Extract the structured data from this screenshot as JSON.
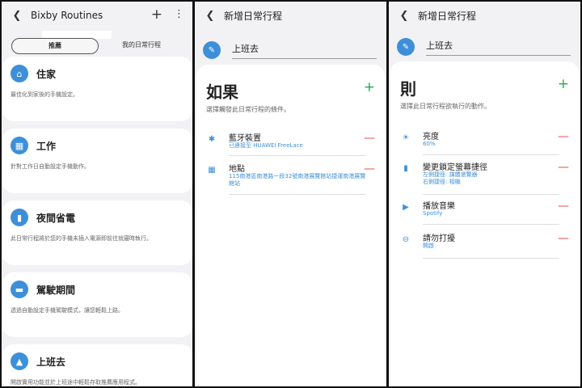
{
  "panel1": {
    "title": "Bixby Routines",
    "tabs": [
      "推薦",
      "我的日常行程"
    ],
    "cards": [
      {
        "title": "住家",
        "desc": "最佳化到家後的手機設定。",
        "icon": "home-icon",
        "glyph": "⌂"
      },
      {
        "title": "工作",
        "desc": "針對工作日自動設定手機動作。",
        "icon": "building-icon",
        "glyph": "▦"
      },
      {
        "title": "夜間省電",
        "desc": "此日常行程將於您的手機未插入電源即前往就寢時執行。",
        "icon": "battery-icon",
        "glyph": "▮"
      },
      {
        "title": "駕駛期間",
        "desc": "透過自動設定手機駕駛模式，讓您輕鬆上路。",
        "icon": "car-icon",
        "glyph": "▬"
      },
      {
        "title": "上班去",
        "desc": "開啟實用功能並於上班途中輕鬆存取推薦應用程式。",
        "icon": "commute-icon",
        "glyph": "▲"
      }
    ]
  },
  "panel2": {
    "title": "新增日常行程",
    "name": "上班去",
    "heading": "如果",
    "subtitle": "選擇觸發此日常行程的條件。",
    "items": [
      {
        "title": "藍牙裝置",
        "sub": "已連接至 HUAWEI FreeLace",
        "icon": "bluetooth-icon",
        "glyph": "✱"
      },
      {
        "title": "地點",
        "sub": "115南港區南港路一段32號南港展覽館站捷運南港展覽館站",
        "icon": "location-icon",
        "glyph": "▦"
      }
    ]
  },
  "panel3": {
    "title": "新增日常行程",
    "name": "上班去",
    "heading": "則",
    "subtitle": "選擇此日常行程欲執行的動作。",
    "items": [
      {
        "title": "亮度",
        "sub": "60%",
        "icon": "brightness-icon",
        "glyph": "☀"
      },
      {
        "title": "變更鎖定螢幕捷徑",
        "sub": "左側捷徑: 謀體瀏覽器\n右側捷徑: 相機",
        "icon": "lockscreen-icon",
        "glyph": "▮"
      },
      {
        "title": "播放音樂",
        "sub": "Spotify",
        "icon": "play-icon",
        "glyph": "▶"
      },
      {
        "title": "請勿打擾",
        "sub": "開啟",
        "icon": "do-not-disturb-icon",
        "glyph": "⊖"
      }
    ]
  },
  "colors": {
    "accent": "#3d8fd9",
    "add": "#2ea44f",
    "remove": "#e05252"
  }
}
